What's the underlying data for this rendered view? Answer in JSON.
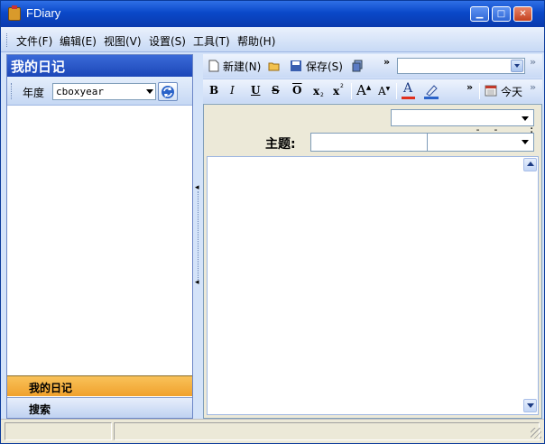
{
  "window": {
    "title": "FDiary",
    "min_label": "▁",
    "max_label": "□",
    "close_label": "✕"
  },
  "menu": [
    "文件(F)",
    "编辑(E)",
    "视图(V)",
    "设置(S)",
    "工具(T)",
    "帮助(H)"
  ],
  "left_panel": {
    "header": "我的日记",
    "year_label": "年度",
    "year_value": "cboxyear",
    "nav": {
      "mine": "我的日记",
      "search": "搜索"
    }
  },
  "toolbar": {
    "new_label": "新建(N)",
    "save_label": "保存(S)",
    "overflow": "»",
    "combo_value": "",
    "today_label": "今天"
  },
  "format": {
    "bold": "B",
    "italic": "I",
    "underline": "U",
    "strike": "S",
    "overline": "O",
    "subscript": "x",
    "superscript": "x"
  },
  "editor": {
    "date_value": "  -  -     :  :",
    "subject_label": "主题:",
    "subject_value": ""
  },
  "colors": {
    "accent": "#0a48c9",
    "nav_active": "#f0a12c",
    "panel_bg": "#d4e3f9"
  }
}
